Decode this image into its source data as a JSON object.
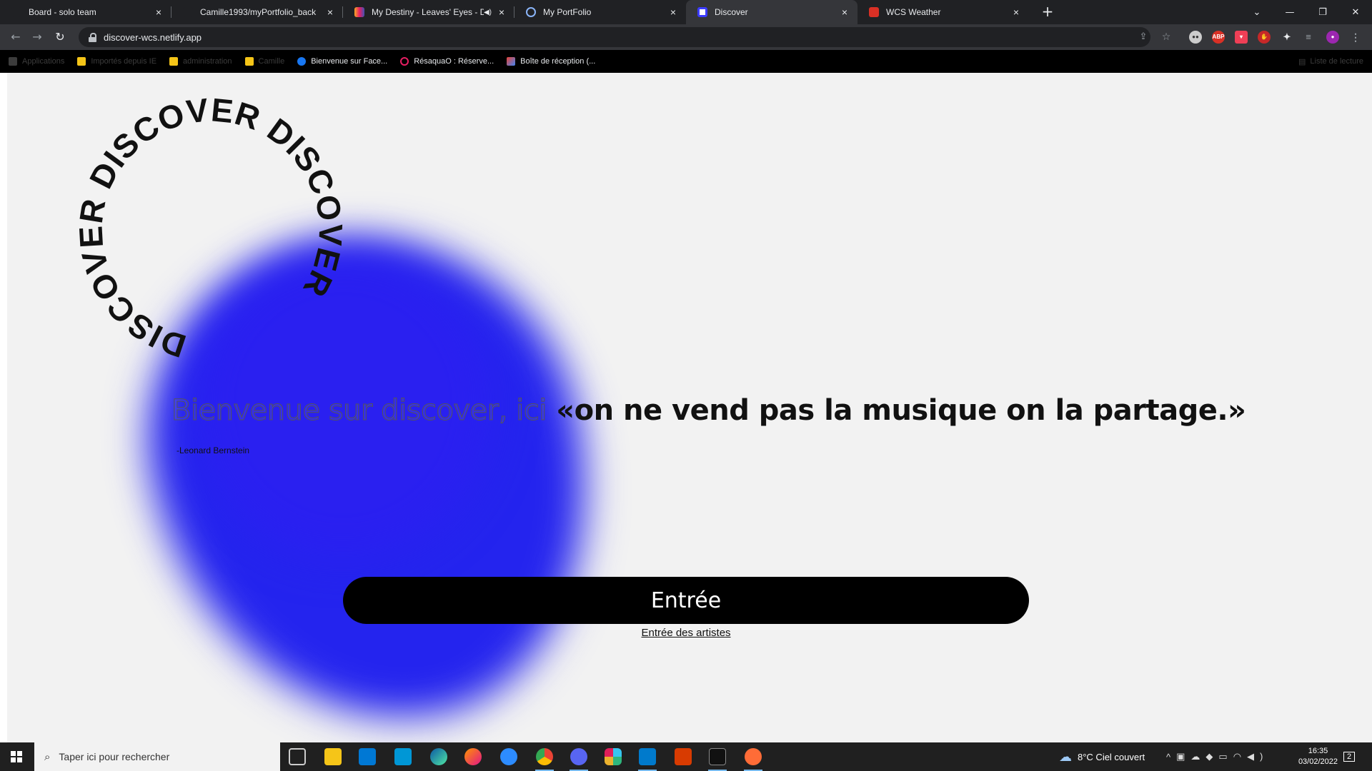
{
  "browser": {
    "tabs": [
      {
        "title": "Board - solo team",
        "favicon_color": "#ffffff"
      },
      {
        "title": "Camille1993/myPortfolio_back",
        "favicon_color": "#ffffff"
      },
      {
        "title": "My Destiny - Leaves' Eyes - D",
        "favicon_color": "#f9a825",
        "playing_audio": true
      },
      {
        "title": "My PortFolio",
        "favicon_color": "#8ab4f8"
      },
      {
        "title": "Discover",
        "favicon_color": "#3b3bff",
        "active": true
      },
      {
        "title": "WCS Weather",
        "favicon_color": "#d93025"
      }
    ],
    "url": "discover-wcs.netlify.app",
    "bookmarks": [
      {
        "label": "Applications",
        "icon_color": "#ea4335",
        "dim": true
      },
      {
        "label": "Importés depuis IE",
        "icon_color": "#fbbc04",
        "dim": true
      },
      {
        "label": "administration",
        "icon_color": "#fbbc04",
        "dim": true
      },
      {
        "label": "Camille",
        "icon_color": "#fbbc04",
        "dim": true
      },
      {
        "label": "Bienvenue sur Face...",
        "icon_color": "#1877f2",
        "dim": false
      },
      {
        "label": "RésaquaO : Réserve...",
        "icon_color": "#e91e63",
        "dim": false
      },
      {
        "label": "Boîte de réception (...",
        "icon_color": "#ea4335",
        "dim": false
      }
    ],
    "reading_list": "Liste de lecture"
  },
  "page": {
    "logo_text": "DISCOVER DISCOVER DISCOVER ",
    "welcome": "Bienvenue sur discover, ici",
    "quote": "«on ne vend pas la musique on la partage.»",
    "author": "-Leonard Bernstein",
    "enter_button": "Entrée",
    "artists_link": "Entrée des artistes",
    "accent_color": "#2424ee"
  },
  "taskbar": {
    "search_placeholder": "Taper ici pour rechercher",
    "weather": "8°C  Ciel couvert",
    "time": "16:35",
    "date": "03/02/2022",
    "notifications": "2"
  }
}
